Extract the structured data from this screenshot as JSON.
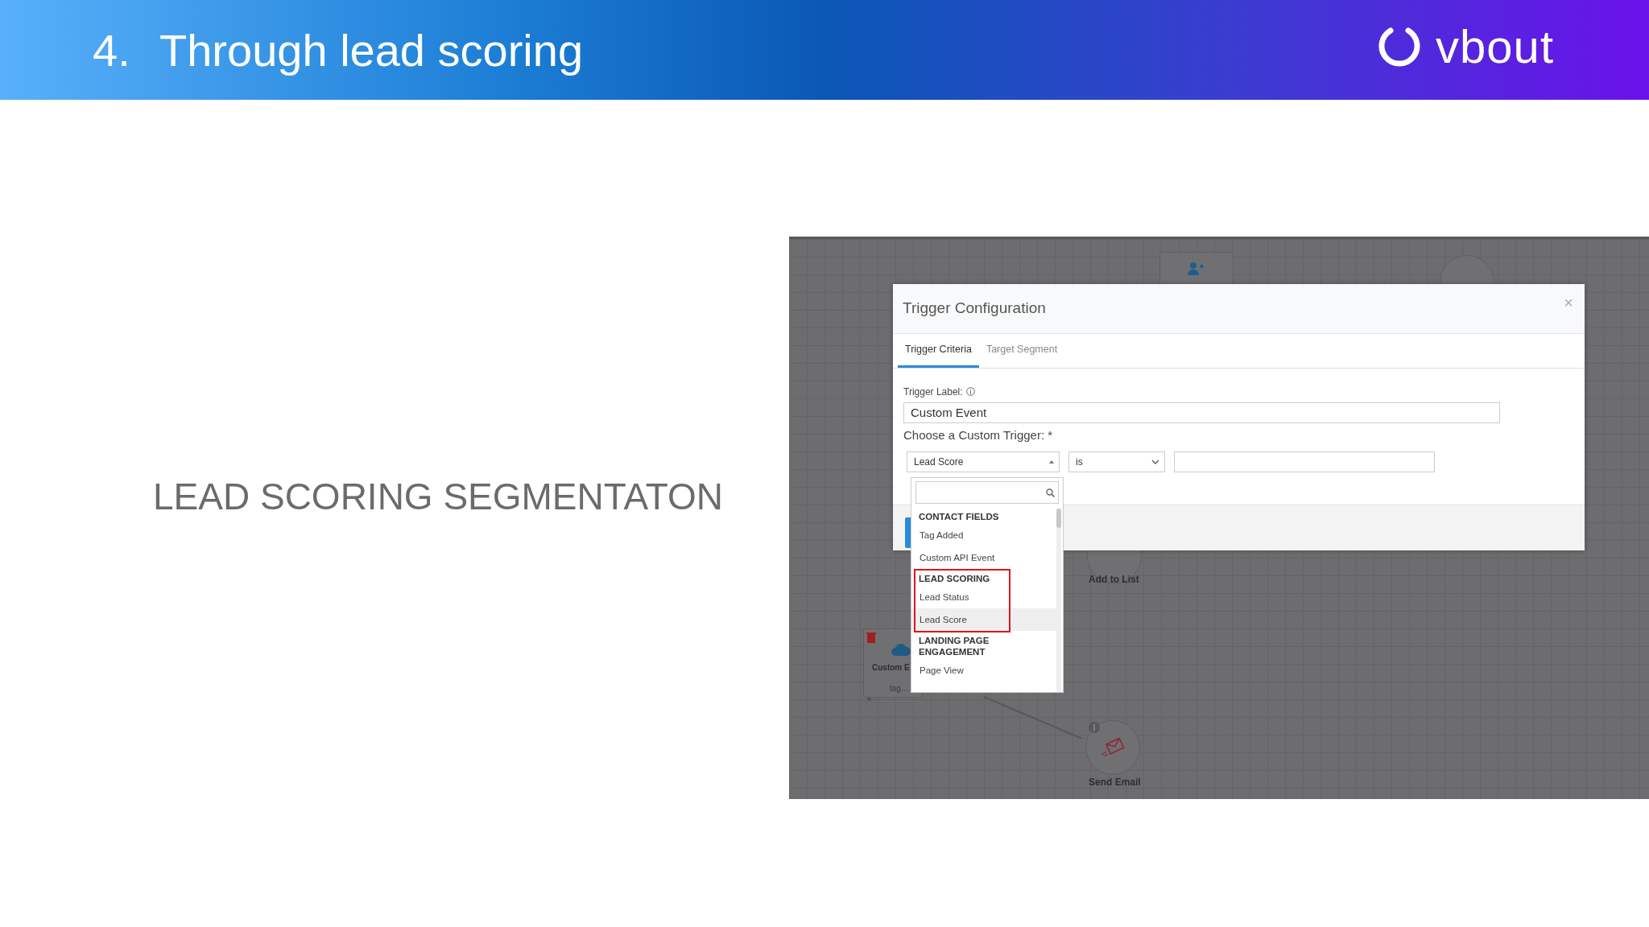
{
  "header": {
    "number": "4.",
    "title": "Through lead scoring",
    "logo_text": "vbout"
  },
  "subtitle": "LEAD SCORING SEGMENTATON",
  "screenshot": {
    "canvas_nodes": [
      {
        "kind": "contact"
      },
      {
        "kind": "round"
      },
      {
        "kind": "list",
        "label": "Add to List"
      },
      {
        "kind": "custom",
        "label": "Custom E",
        "sub": "tag..."
      },
      {
        "kind": "email",
        "label": "Send Email"
      }
    ],
    "modal": {
      "title": "Trigger Configuration",
      "close": "×",
      "tabs": [
        {
          "label": "Trigger Criteria",
          "selected": true
        },
        {
          "label": "Target Segment",
          "selected": false
        }
      ],
      "trigger_label": "Trigger Label:",
      "trigger_value": "Custom Event",
      "choose_label": "Choose a Custom Trigger: *",
      "trigger_select": "Lead Score",
      "operator_select": "is",
      "dropdown": {
        "groups": [
          {
            "heading": "CONTACT FIELDS",
            "highlighted": false,
            "items": [
              {
                "label": "Tag Added",
                "selected": false
              },
              {
                "label": "Custom API Event",
                "selected": false
              }
            ]
          },
          {
            "heading": "LEAD SCORING",
            "highlighted": true,
            "items": [
              {
                "label": "Lead Status",
                "selected": false
              },
              {
                "label": "Lead Score",
                "selected": true
              }
            ]
          },
          {
            "heading": "LANDING PAGE ENGAGEMENT",
            "highlighted": false,
            "items": [
              {
                "label": "Page View",
                "selected": false
              }
            ]
          }
        ]
      }
    }
  }
}
